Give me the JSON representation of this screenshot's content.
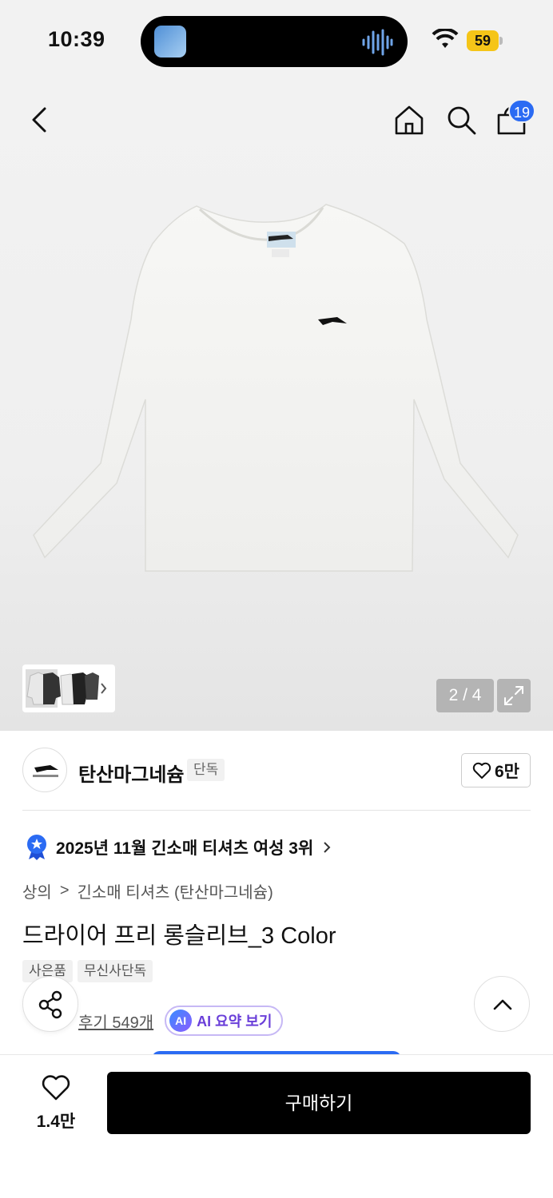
{
  "status_bar": {
    "time": "10:39",
    "battery": "59"
  },
  "header": {
    "cart_count": "19"
  },
  "gallery": {
    "pager": "2 / 4"
  },
  "brand": {
    "name": "탄산마그네슘",
    "badge": "단독",
    "likes": "6만"
  },
  "ranking": {
    "text": "2025년 11월 긴소매 티셔츠 여성 3위"
  },
  "breadcrumb": {
    "level1": "상의",
    "separator": ">",
    "level2": "긴소매 티셔츠 (탄산마그네슘)"
  },
  "product": {
    "title": "드라이어 프리 롱슬리브_3 Color",
    "tags": [
      "사은품",
      "무신사단독"
    ],
    "review_link": "후기 549개",
    "ai_label": "AI",
    "ai_summary": "AI 요약 보기"
  },
  "bottom_bar": {
    "wish_count": "1.4만",
    "buy_label": "구매하기"
  },
  "colors": {
    "accent": "#2b6bf3",
    "battery": "#f5c518",
    "ai_purple": "#6a3fd9"
  }
}
